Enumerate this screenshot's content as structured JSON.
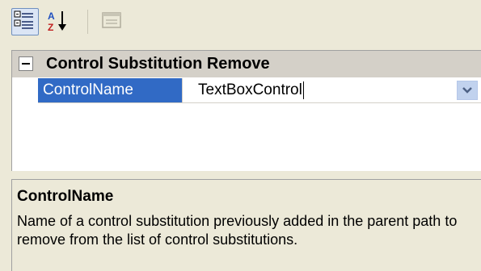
{
  "toolbar": {
    "buttons": [
      {
        "icon": "categorized-icon",
        "active": true
      },
      {
        "icon": "alphabetical-sort-icon",
        "active": false
      },
      {
        "icon": "property-pages-icon",
        "active": false,
        "enabled": false
      }
    ]
  },
  "grid": {
    "category": {
      "label": "Control Substitution Remove",
      "expanded": true,
      "expander_icon": "collapse-box-icon"
    },
    "property": {
      "name": "ControlName",
      "value": "TextBoxControl",
      "selected": true,
      "dropdown_icon": "chevron-down-icon"
    }
  },
  "description": {
    "title": "ControlName",
    "text": "Name of a control substitution previously added in the parent path to remove from the list of control substitutions."
  },
  "colors": {
    "selection": "#316ac5",
    "category_background": "#d4d0c8",
    "panel_background": "#ece9d8",
    "grid_background": "#ffffff"
  }
}
